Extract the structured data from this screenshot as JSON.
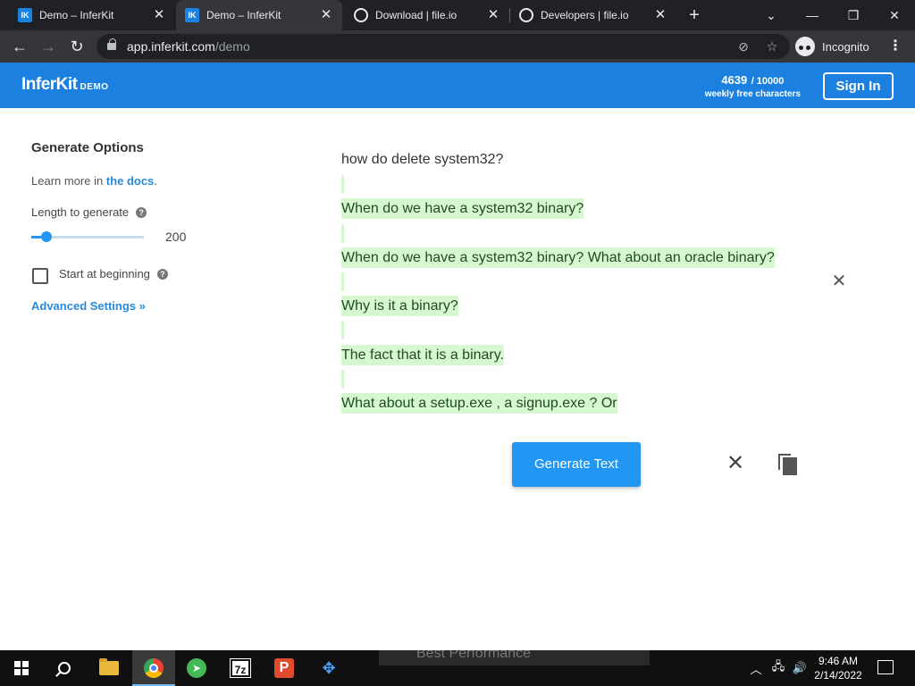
{
  "browser": {
    "tabs": [
      {
        "title": "Demo – InferKit",
        "icon": "inferkit-favicon"
      },
      {
        "title": "Demo – InferKit",
        "icon": "inferkit-favicon"
      },
      {
        "title": "Download | file.io",
        "icon": "globe-icon"
      },
      {
        "title": "Developers | file.io",
        "icon": "globe-icon"
      }
    ],
    "url_host": "app.inferkit.com",
    "url_path": "/demo",
    "incognito_label": "Incognito"
  },
  "app": {
    "logo": "InferKit",
    "logo_tag": "DEMO",
    "quota_used": "4639",
    "quota_total": "/ 10000",
    "quota_label": "weekly free characters",
    "signin": "Sign In",
    "accent_color": "#1b80e0"
  },
  "sidebar": {
    "title": "Generate Options",
    "learn_prefix": "Learn more in ",
    "learn_link": "the docs",
    "learn_suffix": ".",
    "length_label": "Length to generate",
    "length_value": "200",
    "length_fraction": 0.1,
    "start_label": "Start at beginning",
    "start_checked": false,
    "advanced_label": "Advanced Settings »"
  },
  "output": {
    "prompt": "how do delete system32?",
    "generated_lines": [
      "When do we have a system32 binary?",
      "When do we have a system32 binary? What about an oracle binary?",
      "Why is it a binary?",
      "The fact that it is a binary.",
      "What about a setup.exe , a signup.exe ? Or"
    ],
    "generate_button": "Generate Text"
  },
  "taskbar": {
    "ghost_text": "Best Performance",
    "time": "9:46 AM",
    "date": "2/14/2022",
    "sevenzip_label": "7z",
    "p_label": "P"
  }
}
